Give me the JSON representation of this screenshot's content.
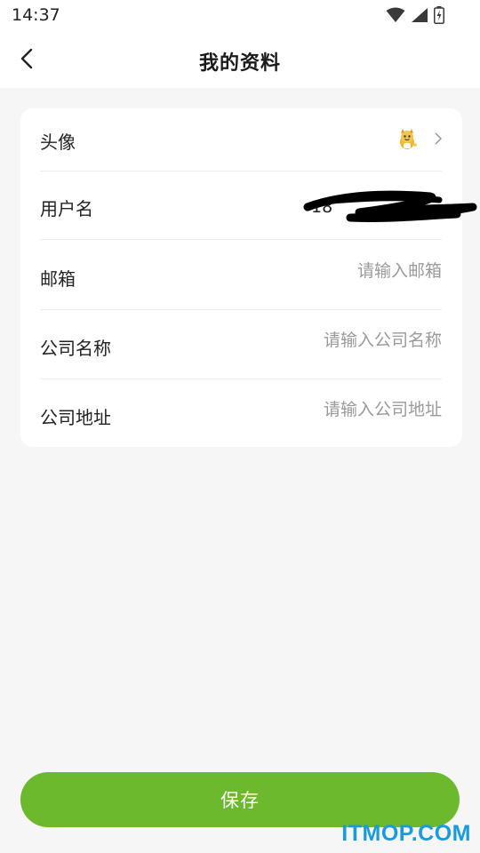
{
  "status_bar": {
    "time": "14:37"
  },
  "header": {
    "title": "我的资料"
  },
  "profile": {
    "avatar_label": "头像",
    "username_label": "用户名",
    "username_value": "18",
    "email_label": "邮箱",
    "email_placeholder": "请输入邮箱",
    "company_name_label": "公司名称",
    "company_name_placeholder": "请输入公司名称",
    "company_address_label": "公司地址",
    "company_address_placeholder": "请输入公司地址"
  },
  "actions": {
    "save_label": "保存"
  },
  "watermark": {
    "text": "ITMOP.COM"
  },
  "colors": {
    "accent": "#6cb92e",
    "background": "#f6f6f6",
    "watermark": "#1a9be0"
  },
  "icons": {
    "back": "back-arrow-icon",
    "avatar": "cartoon-avatar-icon",
    "row_arrow": "chevron-right-icon",
    "wifi": "wifi-icon",
    "signal": "signal-icon",
    "battery": "battery-icon"
  }
}
